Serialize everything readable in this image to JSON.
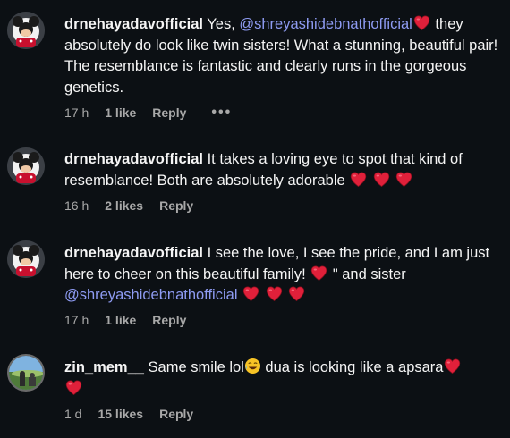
{
  "comments": [
    {
      "username": "drnehayadavofficial",
      "text_before": " Yes, ",
      "mention": "@shreyashidebnathofficial",
      "text_after": " they absolutely do look like twin sisters! What a stunning, beautiful pair! The resemblance is fantastic and clearly runs in the gorgeous genetics.",
      "time": "17 h",
      "likes": "1 like",
      "reply": "Reply",
      "more": "•••"
    },
    {
      "username": "drnehayadavofficial",
      "text": " It takes a loving eye to spot that kind of resemblance! Both are absolutely adorable",
      "time": "16 h",
      "likes": "2 likes",
      "reply": "Reply"
    },
    {
      "username": "drnehayadavofficial",
      "text_before": " I see the love, I see the pride, and I am just here to cheer on this beautiful family! ",
      "text_middle": " \" and sister ",
      "mention": "@shreyashidebnathofficial",
      "time": "17 h",
      "likes": "1 like",
      "reply": "Reply"
    },
    {
      "username": "zin_mem__",
      "text_before": " Same smile lol",
      "text_after": " dua is looking like a apsara",
      "time": "1 d",
      "likes": "15 likes",
      "reply": "Reply"
    }
  ],
  "icons": {
    "heart": "red-heart-icon",
    "laugh": "face-with-tears-of-joy-icon"
  },
  "colors": {
    "background": "#0c1014",
    "text": "#f5f5f5",
    "mention": "#8e9bf2",
    "meta": "#a8a8a8",
    "heart": "#e0203a"
  }
}
